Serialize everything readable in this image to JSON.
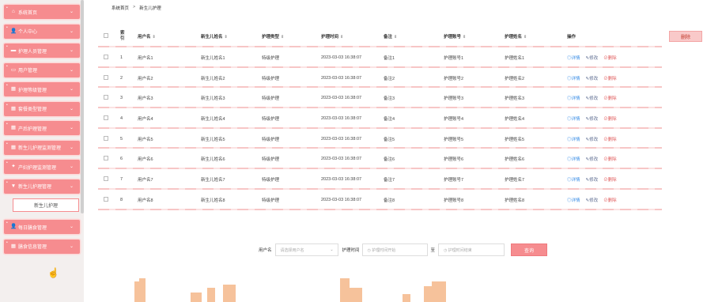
{
  "sidebar": {
    "items": [
      {
        "label": "系统首页",
        "icon": "home-icon",
        "glyph": "⌂"
      },
      {
        "label": "个人中心",
        "icon": "user-icon",
        "glyph": "👤"
      },
      {
        "label": "护理人员管理",
        "icon": "briefcase-icon",
        "glyph": "▬"
      },
      {
        "label": "用户管理",
        "icon": "card-icon",
        "glyph": "▭"
      },
      {
        "label": "护理等级管理",
        "icon": "grid-icon",
        "glyph": "▦"
      },
      {
        "label": "套餐类型管理",
        "icon": "grid-icon",
        "glyph": "▦"
      },
      {
        "label": "产后护理管理",
        "icon": "grid-icon",
        "glyph": "▦"
      },
      {
        "label": "新生儿护理监测管理",
        "icon": "grid-icon",
        "glyph": "▦"
      },
      {
        "label": "产妇护理监测管理",
        "icon": "star-icon",
        "glyph": "✦"
      },
      {
        "label": "新生儿护理管理",
        "icon": "filter-icon",
        "glyph": "▼"
      }
    ],
    "submenu_label": "新生儿护理",
    "items_after": [
      {
        "label": "每日膳食管理",
        "icon": "user-icon",
        "glyph": "👤"
      },
      {
        "label": "膳食信息管理",
        "icon": "grid-icon",
        "glyph": "▦"
      }
    ]
  },
  "breadcrumb": {
    "home": "系统首页",
    "sep": ">",
    "current": "新生儿护理"
  },
  "table": {
    "headers": {
      "index": "索引",
      "username": "用户名",
      "baby_name": "新生儿姓名",
      "type": "护理类型",
      "time": "护理时间",
      "note": "备注",
      "account": "护理账号",
      "nurse_name": "护理姓名",
      "ops": "操作"
    },
    "sort_glyph": "⇕",
    "op_labels": {
      "detail": "◎详情",
      "edit": "✎修改",
      "delete": "⊘删除"
    },
    "rows": [
      {
        "index": "1",
        "username": "用户名1",
        "baby_name": "新生儿姓名1",
        "type": "特级护理",
        "time": "2023-03-03 16:38:07",
        "note": "备注1",
        "account": "护理账号1",
        "nurse_name": "护理姓名1"
      },
      {
        "index": "2",
        "username": "用户名2",
        "baby_name": "新生儿姓名2",
        "type": "特级护理",
        "time": "2023-03-03 16:38:07",
        "note": "备注2",
        "account": "护理账号2",
        "nurse_name": "护理姓名2"
      },
      {
        "index": "3",
        "username": "用户名3",
        "baby_name": "新生儿姓名3",
        "type": "特级护理",
        "time": "2023-03-03 16:38:07",
        "note": "备注3",
        "account": "护理账号3",
        "nurse_name": "护理姓名3"
      },
      {
        "index": "4",
        "username": "用户名4",
        "baby_name": "新生儿姓名4",
        "type": "特级护理",
        "time": "2023-03-03 16:38:07",
        "note": "备注4",
        "account": "护理账号4",
        "nurse_name": "护理姓名4"
      },
      {
        "index": "5",
        "username": "用户名5",
        "baby_name": "新生儿姓名5",
        "type": "特级护理",
        "time": "2023-03-03 16:38:07",
        "note": "备注5",
        "account": "护理账号5",
        "nurse_name": "护理姓名5"
      },
      {
        "index": "6",
        "username": "用户名6",
        "baby_name": "新生儿姓名6",
        "type": "特级护理",
        "time": "2023-03-03 16:38:07",
        "note": "备注6",
        "account": "护理账号6",
        "nurse_name": "护理姓名6"
      },
      {
        "index": "7",
        "username": "用户名7",
        "baby_name": "新生儿姓名7",
        "type": "特级护理",
        "time": "2023-03-03 16:38:07",
        "note": "备注7",
        "account": "护理账号7",
        "nurse_name": "护理姓名7"
      },
      {
        "index": "8",
        "username": "用户名8",
        "baby_name": "新生儿姓名8",
        "type": "特级护理",
        "time": "2023-03-03 16:38:07",
        "note": "备注8",
        "account": "护理账号8",
        "nurse_name": "护理姓名8"
      }
    ]
  },
  "delete_button": "删除",
  "search": {
    "username_label": "用户名",
    "username_placeholder": "请选择用户名",
    "time_label": "护理时间",
    "time_start_placeholder": "◷ 护理时间开始",
    "to_label": "至",
    "time_end_placeholder": "◷ 护理时间结束",
    "button": "查询"
  },
  "colors": {
    "accent": "#f68c8f",
    "accent_light": "#f9c9c9",
    "sidebar_bg": "#f3efee",
    "decoration": "#f6c29b"
  }
}
